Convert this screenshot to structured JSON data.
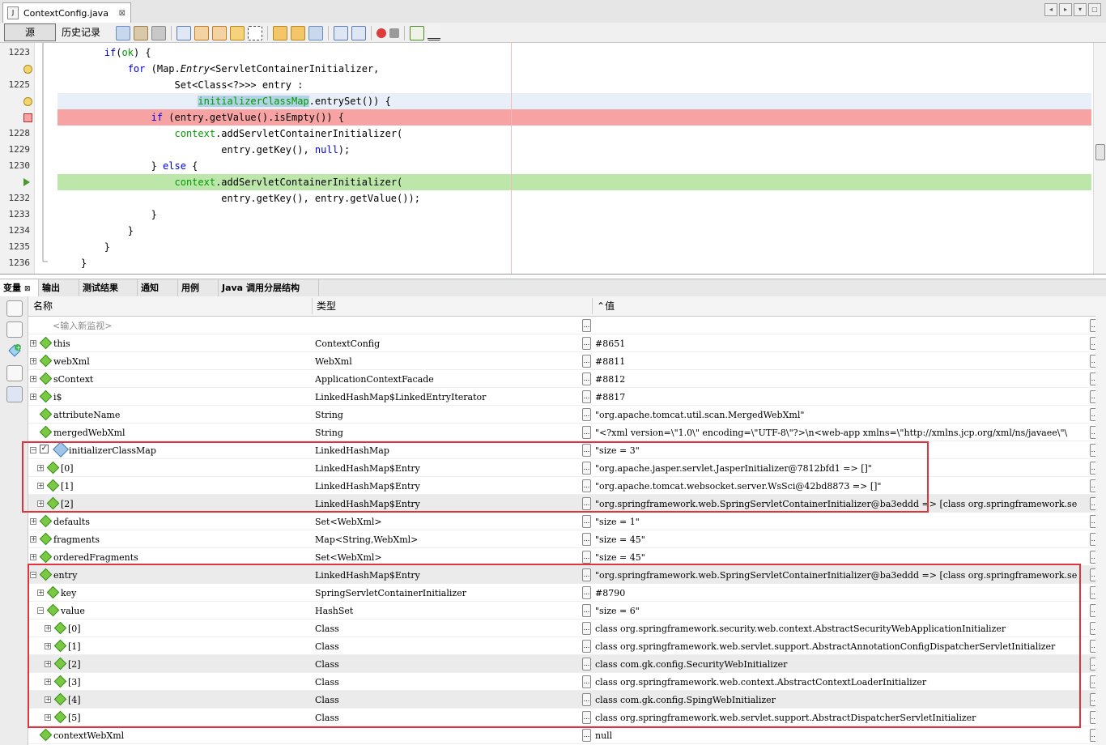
{
  "file_tab": {
    "title": "ContextConfig.java",
    "close": "⊠"
  },
  "toolbar": {
    "source_button": "源",
    "history_button": "历史记录"
  },
  "editor": {
    "lines": [
      {
        "no": "1223",
        "mark": "",
        "hl": "",
        "indent": "        ",
        "parts": [
          [
            "kw",
            "if"
          ],
          [
            "",
            "("
          ],
          [
            "fld",
            "ok"
          ],
          [
            "",
            ") {"
          ]
        ]
      },
      {
        "no": "",
        "mark": "warn",
        "hl": "",
        "indent": "            ",
        "parts": [
          [
            "kw",
            "for"
          ],
          [
            "",
            " (Map."
          ],
          [
            "it",
            "Entry"
          ],
          [
            "",
            "<ServletContainerInitializer,"
          ]
        ]
      },
      {
        "no": "1225",
        "mark": "",
        "hl": "",
        "indent": "                    ",
        "parts": [
          [
            "",
            "Set<Class<?>>> entry :"
          ]
        ]
      },
      {
        "no": "",
        "mark": "warn",
        "hl": "blue",
        "indent": "                        ",
        "parts": [
          [
            "mrk",
            "initializerClassMap"
          ],
          [
            "",
            ".entrySet()) {"
          ]
        ]
      },
      {
        "no": "",
        "mark": "break",
        "hl": "red",
        "indent": "                ",
        "parts": [
          [
            "kw",
            "if"
          ],
          [
            "",
            " (entry.getValue().isEmpty()) {"
          ]
        ]
      },
      {
        "no": "1228",
        "mark": "",
        "hl": "",
        "indent": "                    ",
        "parts": [
          [
            "fld",
            "context"
          ],
          [
            "",
            ".addServletContainerInitializer("
          ]
        ]
      },
      {
        "no": "1229",
        "mark": "",
        "hl": "",
        "indent": "                            ",
        "parts": [
          [
            "",
            "entry.getKey(), "
          ],
          [
            "kw",
            "null"
          ],
          [
            "",
            ");"
          ]
        ]
      },
      {
        "no": "1230",
        "mark": "",
        "hl": "",
        "indent": "                ",
        "parts": [
          [
            "",
            "} "
          ],
          [
            "kw",
            "else"
          ],
          [
            "",
            " {"
          ]
        ]
      },
      {
        "no": "",
        "mark": "pc",
        "hl": "green",
        "indent": "                    ",
        "parts": [
          [
            "fld",
            "context"
          ],
          [
            "",
            ".addServletContainerInitializer("
          ]
        ]
      },
      {
        "no": "1232",
        "mark": "",
        "hl": "",
        "indent": "                            ",
        "parts": [
          [
            "",
            "entry.getKey(), entry.getValue());"
          ]
        ]
      },
      {
        "no": "1233",
        "mark": "",
        "hl": "",
        "indent": "                ",
        "parts": [
          [
            "",
            "}"
          ]
        ]
      },
      {
        "no": "1234",
        "mark": "",
        "hl": "",
        "indent": "            ",
        "parts": [
          [
            "",
            "}"
          ]
        ]
      },
      {
        "no": "1235",
        "mark": "",
        "hl": "",
        "indent": "        ",
        "parts": [
          [
            "",
            "}"
          ]
        ]
      },
      {
        "no": "1236",
        "mark": "",
        "hl": "",
        "indent": "    ",
        "parts": [
          [
            "",
            "}"
          ]
        ]
      }
    ]
  },
  "bottom_tabs": [
    {
      "label": "变量",
      "close": "⊠",
      "active": true
    },
    {
      "label": "输出",
      "active": false
    },
    {
      "label": "测试结果",
      "active": false
    },
    {
      "label": "通知",
      "active": false
    },
    {
      "label": "用例",
      "active": false
    },
    {
      "label": "Java 调用分层结构",
      "active": false
    }
  ],
  "variables": {
    "headers": {
      "name": "名称",
      "type": "类型",
      "value": "值",
      "sort_arrow": "⌃"
    },
    "ellipsis": "...",
    "rows": [
      {
        "level": 0,
        "exp": "",
        "icon": "none",
        "name": "<输入新监视>",
        "type": "",
        "value": "",
        "placeholder": true
      },
      {
        "level": 0,
        "exp": "+",
        "icon": "diamond",
        "name": "this",
        "type": "ContextConfig",
        "value": "#8651"
      },
      {
        "level": 0,
        "exp": "+",
        "icon": "diamond",
        "name": "webXml",
        "type": "WebXml",
        "value": "#8811"
      },
      {
        "level": 0,
        "exp": "+",
        "icon": "diamond",
        "name": "sContext",
        "type": "ApplicationContextFacade",
        "value": "#8812"
      },
      {
        "level": 0,
        "exp": "+",
        "icon": "diamond",
        "name": "i$",
        "type": "LinkedHashMap$LinkedEntryIterator",
        "value": "#8817"
      },
      {
        "level": 0,
        "exp": "",
        "icon": "diamond",
        "name": "attributeName",
        "type": "String",
        "value": "\"org.apache.tomcat.util.scan.MergedWebXml\""
      },
      {
        "level": 0,
        "exp": "",
        "icon": "diamond",
        "name": "mergedWebXml",
        "type": "String",
        "value": "\"<?xml version=\\\"1.0\\\" encoding=\\\"UTF-8\\\"?>\\n<web-app xmlns=\\\"http://xmlns.jcp.org/xml/ns/javaee\\\"\\"
      },
      {
        "level": 0,
        "exp": "−",
        "icon": "gem",
        "check": true,
        "name": "initializerClassMap",
        "type": "LinkedHashMap",
        "value": "\"size = 3\""
      },
      {
        "level": 1,
        "exp": "+",
        "icon": "diamond",
        "name": "[0]",
        "type": "LinkedHashMap$Entry",
        "value": "\"org.apache.jasper.servlet.JasperInitializer@7812bfd1 => []\""
      },
      {
        "level": 1,
        "exp": "+",
        "icon": "diamond",
        "name": "[1]",
        "type": "LinkedHashMap$Entry",
        "value": "\"org.apache.tomcat.websocket.server.WsSci@42bd8873 => []\""
      },
      {
        "level": 1,
        "exp": "+",
        "icon": "diamond",
        "name": "[2]",
        "type": "LinkedHashMap$Entry",
        "value": "\"org.springframework.web.SpringServletContainerInitializer@ba3eddd => [class org.springframework.se",
        "shade": true
      },
      {
        "level": 0,
        "exp": "+",
        "icon": "diamond",
        "name": "defaults",
        "type": "Set<WebXml>",
        "value": "\"size = 1\""
      },
      {
        "level": 0,
        "exp": "+",
        "icon": "diamond",
        "name": "fragments",
        "type": "Map<String,WebXml>",
        "value": "\"size = 45\""
      },
      {
        "level": 0,
        "exp": "+",
        "icon": "diamond",
        "name": "orderedFragments",
        "type": "Set<WebXml>",
        "value": "\"size = 45\""
      },
      {
        "level": 0,
        "exp": "−",
        "icon": "diamond",
        "name": "entry",
        "type": "LinkedHashMap$Entry",
        "value": "\"org.springframework.web.SpringServletContainerInitializer@ba3eddd => [class org.springframework.se",
        "shade": true
      },
      {
        "level": 1,
        "exp": "+",
        "icon": "diamond",
        "name": "key",
        "type": "SpringServletContainerInitializer",
        "value": "#8790"
      },
      {
        "level": 1,
        "exp": "−",
        "icon": "diamond",
        "name": "value",
        "type": "HashSet",
        "value": "\"size = 6\""
      },
      {
        "level": 2,
        "exp": "+",
        "icon": "diamond",
        "name": "[0]",
        "type": "Class",
        "value": "class org.springframework.security.web.context.AbstractSecurityWebApplicationInitializer"
      },
      {
        "level": 2,
        "exp": "+",
        "icon": "diamond",
        "name": "[1]",
        "type": "Class",
        "value": "class org.springframework.web.servlet.support.AbstractAnnotationConfigDispatcherServletInitializer"
      },
      {
        "level": 2,
        "exp": "+",
        "icon": "diamond",
        "name": "[2]",
        "type": "Class",
        "value": "class com.gk.config.SecurityWebInitializer",
        "shade": true
      },
      {
        "level": 2,
        "exp": "+",
        "icon": "diamond",
        "name": "[3]",
        "type": "Class",
        "value": "class org.springframework.web.context.AbstractContextLoaderInitializer"
      },
      {
        "level": 2,
        "exp": "+",
        "icon": "diamond",
        "name": "[4]",
        "type": "Class",
        "value": "class com.gk.config.SpingWebInitializer",
        "shade": true
      },
      {
        "level": 2,
        "exp": "+",
        "icon": "diamond",
        "name": "[5]",
        "type": "Class",
        "value": "class org.springframework.web.servlet.support.AbstractDispatcherServletInitializer"
      },
      {
        "level": 0,
        "exp": "",
        "icon": "diamond",
        "name": "contextWebXml",
        "type": "",
        "value": "null"
      }
    ]
  },
  "colors": {
    "highlight_box": "#e0333b",
    "breakpoint_line": "#f8a3a3",
    "current_line": "#bde6aa"
  }
}
